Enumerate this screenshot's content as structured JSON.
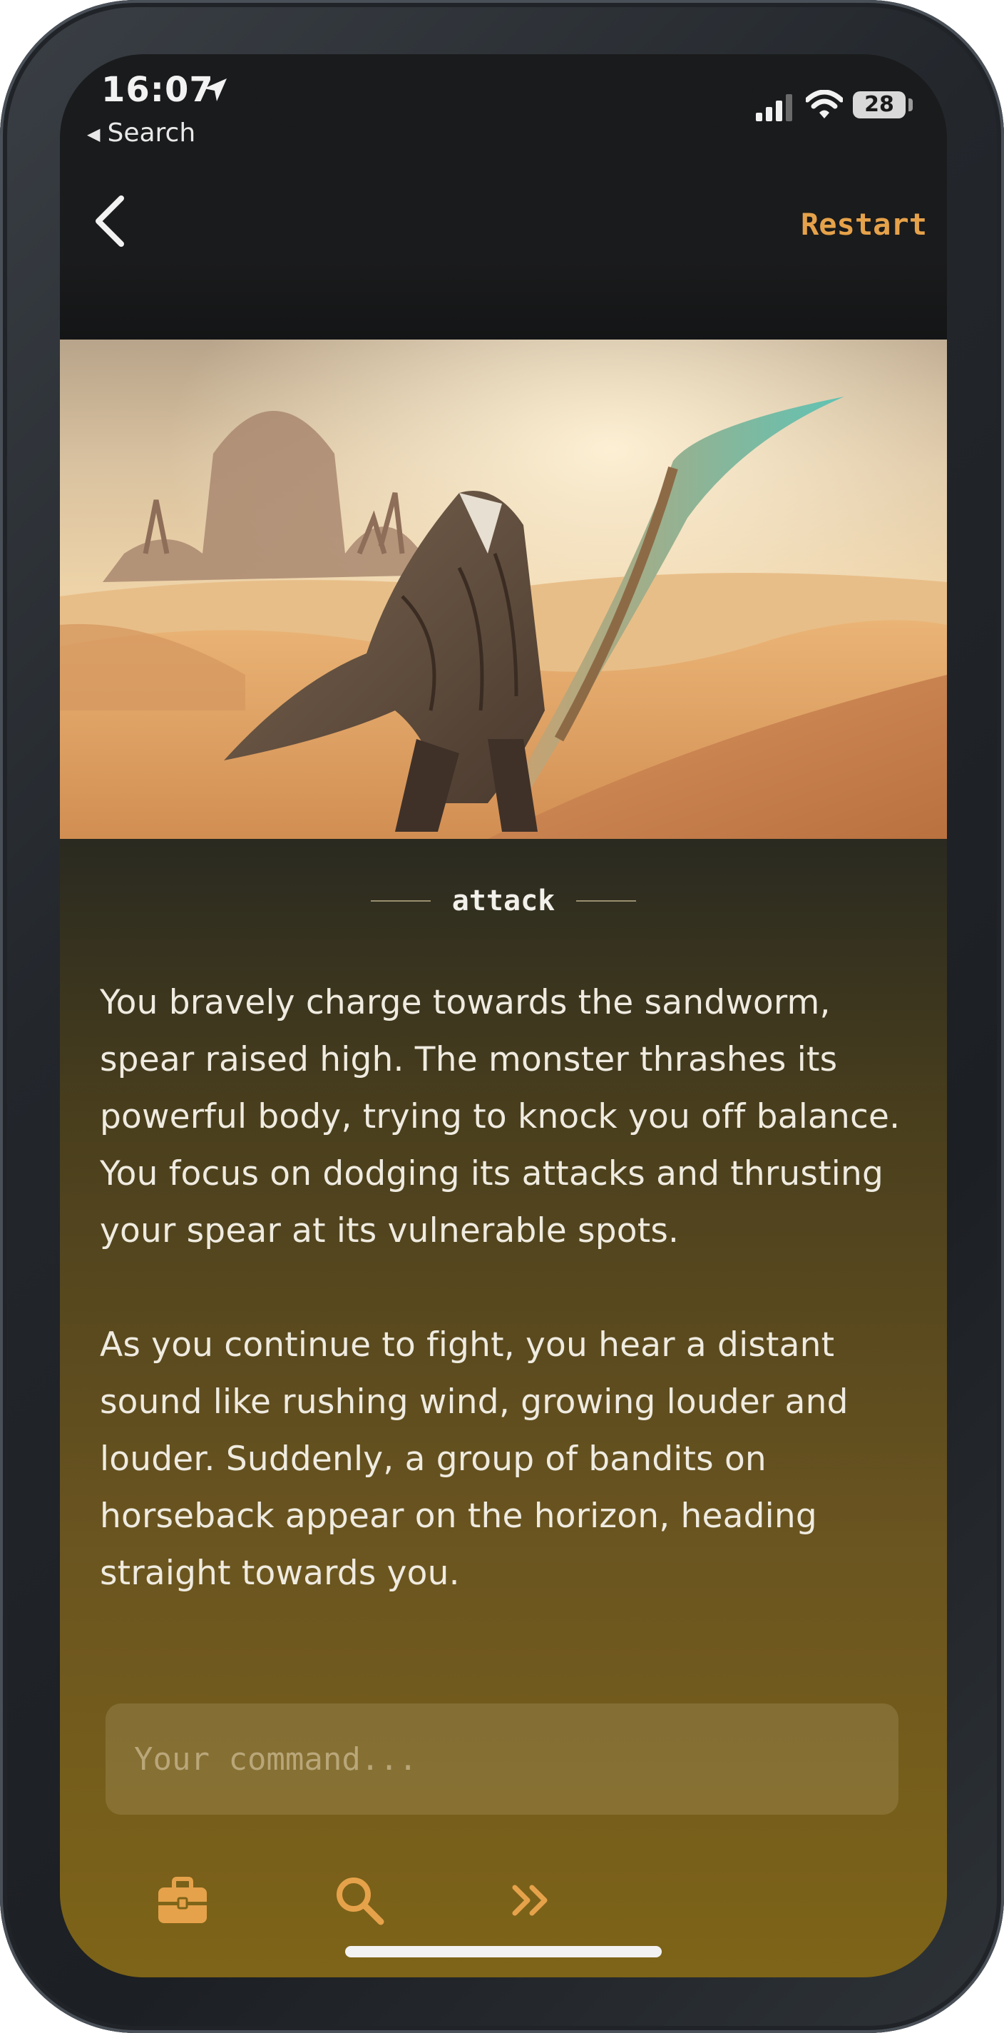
{
  "status_bar": {
    "time": "16:07",
    "back_app_label": "Search",
    "battery": "28"
  },
  "header": {
    "restart_label": "Restart"
  },
  "scene": {
    "command_heading": "attack"
  },
  "story": {
    "paragraphs": [
      "You bravely charge towards the sandworm, spear raised high. The monster thrashes its powerful body, trying to knock you off balance. You focus on dodging its attacks and thrusting your spear at its vulnerable spots.",
      "As you continue to fight, you hear a distant sound like rushing wind, growing louder and louder. Suddenly, a group of bandits on horseback appear on the horizon, heading straight towards you."
    ]
  },
  "command_input": {
    "placeholder": "Your command..."
  },
  "toolbar": {
    "items": [
      "inventory-icon",
      "search-icon",
      "skip-icon"
    ]
  },
  "colors": {
    "accent": "#e6a24a",
    "text": "#efebe0"
  }
}
